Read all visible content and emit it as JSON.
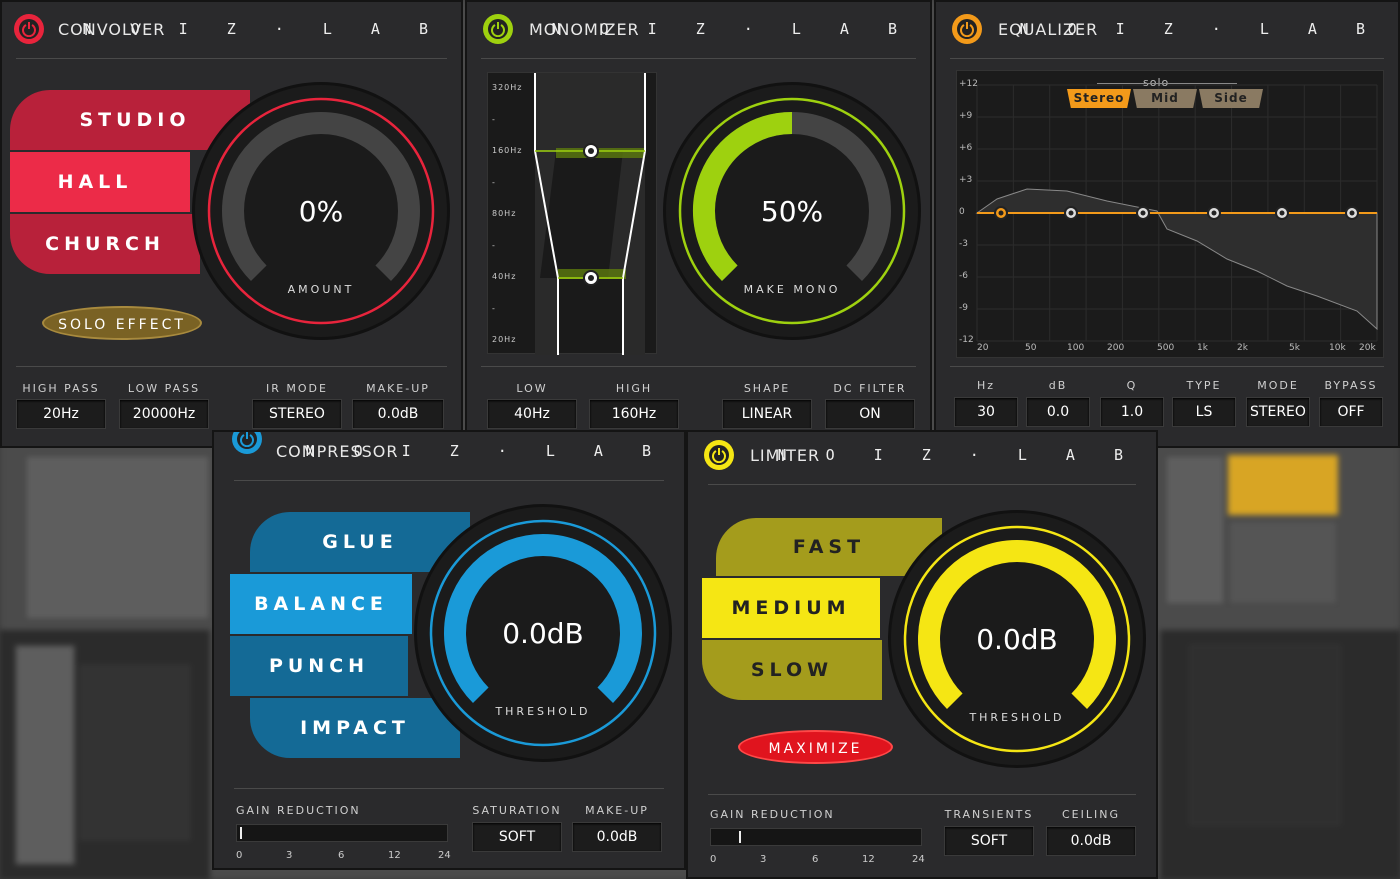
{
  "brand": "N O I Z · L A B",
  "convolver": {
    "title": "CONVOLVER",
    "accent": "#e8243c",
    "modes": [
      "STUDIO",
      "HALL",
      "CHURCH"
    ],
    "knob_value": "0%",
    "knob_label": "AMOUNT",
    "knob_fill": 0.0,
    "solo_label": "SOLO EFFECT",
    "params": [
      {
        "label": "HIGH PASS",
        "value": "20Hz"
      },
      {
        "label": "LOW PASS",
        "value": "20000Hz"
      },
      {
        "label": "IR MODE",
        "value": "STEREO"
      },
      {
        "label": "MAKE-UP",
        "value": "0.0dB"
      }
    ]
  },
  "monomizer": {
    "title": "MONOMIZER",
    "accent": "#9ed10f",
    "freq_labels": [
      "320Hz",
      "-",
      "160Hz",
      "-",
      "80Hz",
      "-",
      "40Hz",
      "-",
      "20Hz"
    ],
    "knob_value": "50%",
    "knob_label": "MAKE MONO",
    "knob_fill": 0.5,
    "params": [
      {
        "label": "LOW",
        "value": "40Hz"
      },
      {
        "label": "HIGH",
        "value": "160Hz"
      },
      {
        "label": "SHAPE",
        "value": "LINEAR"
      },
      {
        "label": "DC FILTER",
        "value": "ON"
      }
    ]
  },
  "equalizer": {
    "title": "EQUALIZER",
    "accent": "#f39a1a",
    "solo_label": "solo",
    "solo_tabs": [
      "Stereo",
      "Mid",
      "Side"
    ],
    "y_labels": [
      "+12",
      "+9",
      "+6",
      "+3",
      "0",
      "-3",
      "-6",
      "-9",
      "-12"
    ],
    "x_labels": [
      "20",
      "50",
      "100",
      "200",
      "500",
      "1k",
      "2k",
      "5k",
      "10k",
      "20k"
    ],
    "params": [
      {
        "label": "Hz",
        "value": "30"
      },
      {
        "label": "dB",
        "value": "0.0"
      },
      {
        "label": "Q",
        "value": "1.0"
      },
      {
        "label": "TYPE",
        "value": "LS"
      },
      {
        "label": "MODE",
        "value": "STEREO"
      },
      {
        "label": "BYPASS",
        "value": "OFF"
      }
    ]
  },
  "compressor": {
    "title": "COMPRESSOR",
    "accent": "#1a9ad8",
    "modes": [
      "GLUE",
      "BALANCE",
      "PUNCH",
      "IMPACT"
    ],
    "knob_value": "0.0dB",
    "knob_label": "THRESHOLD",
    "knob_fill": 1.0,
    "gr_label": "GAIN REDUCTION",
    "gr_ticks": [
      "0",
      "3",
      "6",
      "12",
      "24"
    ],
    "params": [
      {
        "label": "SATURATION",
        "value": "SOFT"
      },
      {
        "label": "MAKE-UP",
        "value": "0.0dB"
      }
    ]
  },
  "limiter": {
    "title": "LIMITER",
    "accent": "#f5e614",
    "modes": [
      "FAST",
      "MEDIUM",
      "SLOW"
    ],
    "knob_value": "0.0dB",
    "knob_label": "THRESHOLD",
    "knob_fill": 1.0,
    "maximize_label": "MAXIMIZE",
    "gr_label": "GAIN REDUCTION",
    "gr_ticks": [
      "0",
      "3",
      "6",
      "12",
      "24"
    ],
    "params": [
      {
        "label": "TRANSIENTS",
        "value": "SOFT"
      },
      {
        "label": "CEILING",
        "value": "0.0dB"
      }
    ]
  }
}
